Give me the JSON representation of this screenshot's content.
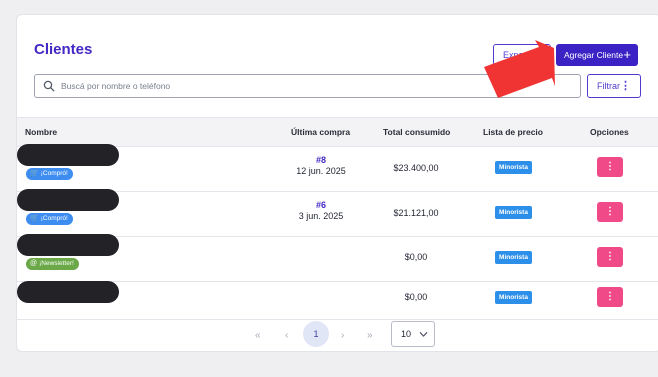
{
  "header": {
    "title": "Clientes",
    "export_label": "Exportar",
    "add_label": "Agregar Cliente",
    "add_icon": "+",
    "filter_label": "Filtrar",
    "filter_icon": "⋮"
  },
  "search": {
    "placeholder": "Buscá por nombre o teléfono"
  },
  "table": {
    "columns": [
      "Nombre",
      "Última compra",
      "Total consumido",
      "Lista de precio",
      "Opciones"
    ],
    "rows": [
      {
        "badge": "¡Compró!",
        "badge_icon": "cart-icon",
        "badge_color": "#3d8cf0",
        "order_num": "#8",
        "order_date": "12 jun. 2025",
        "total": "$23.400,00",
        "price_list": "Minorista",
        "options": "⋮"
      },
      {
        "badge": "¡Compró!",
        "badge_icon": "cart-icon",
        "badge_color": "#3d8cf0",
        "order_num": "#6",
        "order_date": "3 jun. 2025",
        "total": "$21.121,00",
        "price_list": "Minorista",
        "options": "⋮"
      },
      {
        "badge": "¡Newsletter!",
        "badge_icon": "at-icon",
        "badge_color": "#6aa848",
        "order_num": "",
        "order_date": "",
        "total": "$0,00",
        "price_list": "Minorista",
        "options": "⋮"
      },
      {
        "badge": "",
        "badge_icon": "",
        "badge_color": "",
        "order_num": "",
        "order_date": "",
        "total": "$0,00",
        "price_list": "Minorista",
        "options": "⋮"
      }
    ]
  },
  "pagination": {
    "first": "«",
    "prev": "‹",
    "current": "1",
    "next": "›",
    "last": "»",
    "per_page": "10"
  },
  "colors": {
    "accent": "#3b22c4",
    "options_button": "#f04a88",
    "price_tag": "#2c8fea",
    "annotation_arrow": "#f03434"
  }
}
